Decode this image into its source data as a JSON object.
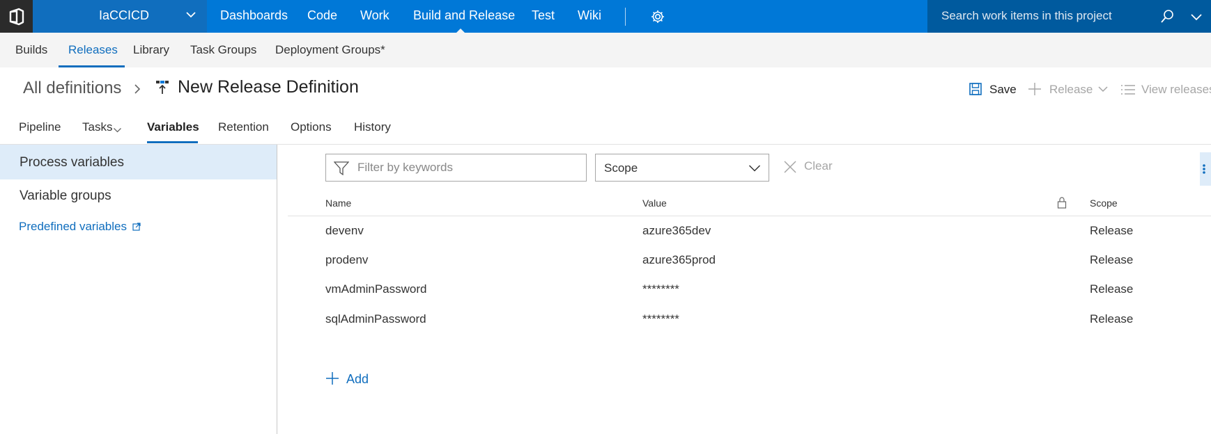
{
  "topnav": {
    "project": "IaCCICD",
    "links": [
      "Dashboards",
      "Code",
      "Work",
      "Build and Release",
      "Test",
      "Wiki"
    ],
    "active": "Build and Release",
    "search_placeholder": "Search work items in this project"
  },
  "subnav": {
    "links": [
      "Builds",
      "Releases",
      "Library",
      "Task Groups",
      "Deployment Groups*"
    ],
    "active": "Releases"
  },
  "header": {
    "breadcrumb_root": "All definitions",
    "title": "New Release Definition",
    "save_label": "Save",
    "release_label": "Release",
    "view_releases_label": "View releases"
  },
  "tabs": {
    "items": [
      "Pipeline",
      "Tasks",
      "Variables",
      "Retention",
      "Options",
      "History"
    ],
    "active": "Variables"
  },
  "left_panel": {
    "process_variables": "Process variables",
    "variable_groups": "Variable groups",
    "predefined_variables": "Predefined variables"
  },
  "filter": {
    "placeholder": "Filter by keywords",
    "scope_label": "Scope",
    "clear_label": "Clear"
  },
  "table": {
    "columns": {
      "name": "Name",
      "value": "Value",
      "scope": "Scope"
    },
    "rows": [
      {
        "name": "devenv",
        "value": "azure365dev",
        "scope": "Release"
      },
      {
        "name": "prodenv",
        "value": "azure365prod",
        "scope": "Release"
      },
      {
        "name": "vmAdminPassword",
        "value": "********",
        "scope": "Release"
      },
      {
        "name": "sqlAdminPassword",
        "value": "********",
        "scope": "Release"
      }
    ]
  },
  "add_label": "Add",
  "colors": {
    "brand_blue": "#0078d7",
    "project_blue": "#106ebe",
    "search_blue": "#005a9e",
    "link_blue": "#106ebe",
    "selected_bg": "#deecf9"
  }
}
